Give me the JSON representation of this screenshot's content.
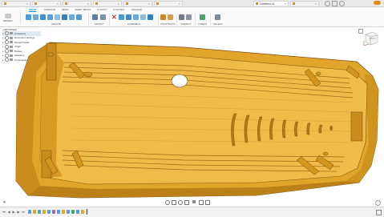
{
  "tabs": [
    {
      "label": "",
      "active": false
    },
    {
      "label": "",
      "active": false
    },
    {
      "label": "",
      "active": false
    },
    {
      "label": "",
      "active": false
    },
    {
      "label": "",
      "active": false
    },
    {
      "label": "",
      "active": false
    },
    {
      "label": "Untitled v1",
      "active": true
    },
    {
      "label": "",
      "active": false
    }
  ],
  "ribbon": {
    "tabs": [
      "SOLID",
      "SURFACE",
      "MESH",
      "SHEET METAL",
      "PLASTIC",
      "UTILITIES",
      "MANAGE"
    ],
    "active_tab": "SOLID",
    "workspace_label": "DESIGN",
    "groups": [
      "CREATE",
      "MODIFY",
      "ASSEMBLE",
      "CONSTRUCT",
      "INSPECT",
      "INSERT",
      "SELECT"
    ]
  },
  "browser": {
    "title": "BROWSER",
    "rows": [
      {
        "label": "(Unsaved)",
        "selected": true
      },
      {
        "label": "Document Settings"
      },
      {
        "label": "Named Views"
      },
      {
        "label": "Origin"
      },
      {
        "label": "Bodies"
      },
      {
        "label": "Sketches"
      },
      {
        "label": "Construction"
      }
    ]
  },
  "viewcube": {
    "face": "RIGHT"
  },
  "colors": {
    "part": "#e5a92e",
    "part_light": "#f2c25a",
    "part_dark": "#a8741a",
    "accent": "#0696d7"
  },
  "icons": {
    "timeline_controls": [
      "first-frame-icon",
      "prev-frame-icon",
      "play-icon",
      "next-frame-icon",
      "last-frame-icon"
    ],
    "nav": [
      "orbit-icon",
      "pan-icon",
      "zoom-icon",
      "fit-icon",
      "display-settings-icon",
      "grid-icon",
      "viewports-icon"
    ]
  }
}
